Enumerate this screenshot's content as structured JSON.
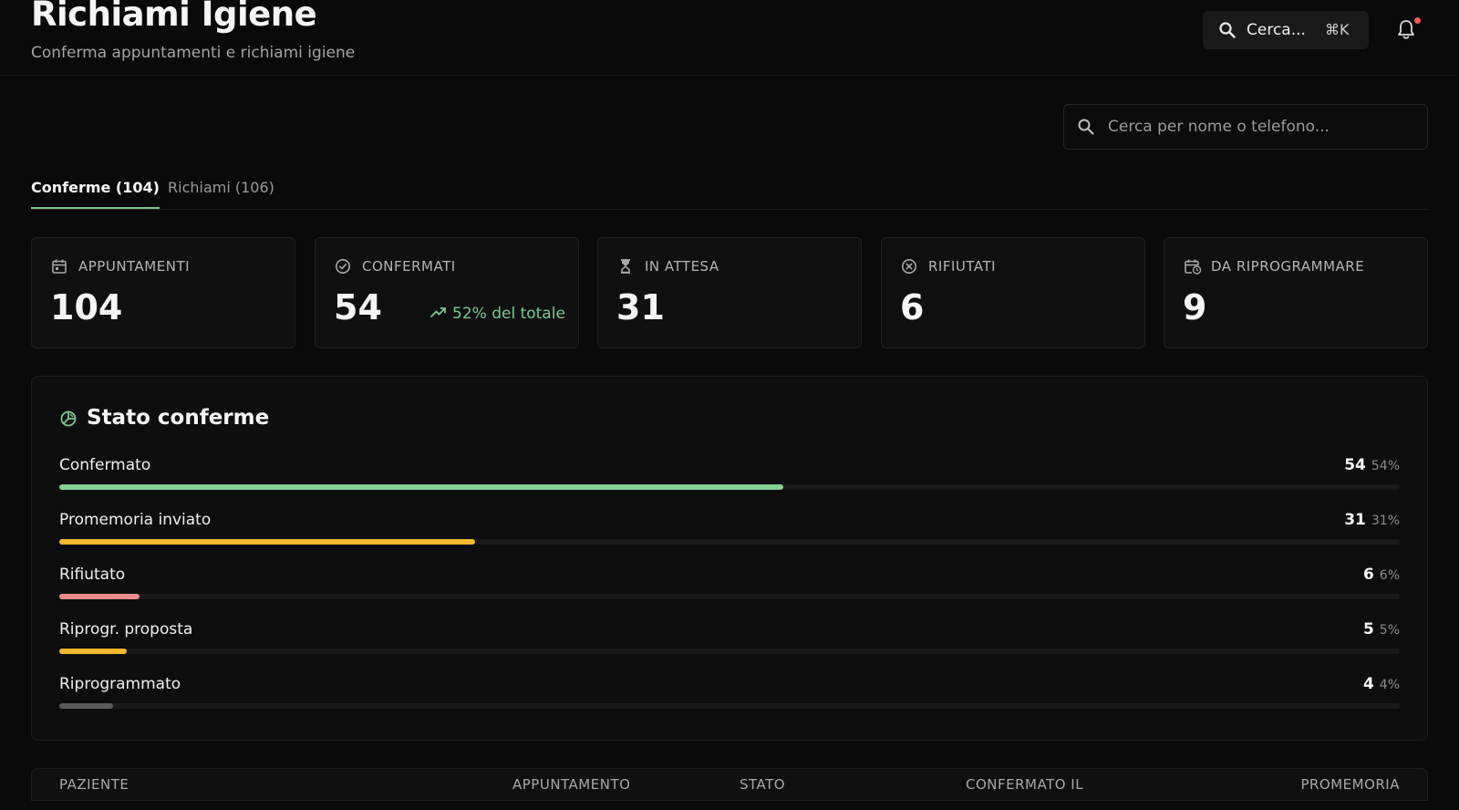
{
  "header": {
    "title": "Richiami Igiene",
    "subtitle": "Conferma appuntamenti e richiami igiene",
    "search_label": "Cerca...",
    "search_shortcut": "⌘K"
  },
  "patient_search": {
    "placeholder": "Cerca per nome o telefono..."
  },
  "tabs": [
    {
      "label": "Conferme (104)",
      "active": true
    },
    {
      "label": "Richiami (106)",
      "active": false
    }
  ],
  "stats": [
    {
      "label": "APPUNTAMENTI",
      "value": "104",
      "icon": "calendar-icon"
    },
    {
      "label": "CONFERMATI",
      "value": "54",
      "icon": "check-circle-icon",
      "trend": "52% del totale"
    },
    {
      "label": "IN ATTESA",
      "value": "31",
      "icon": "hourglass-icon"
    },
    {
      "label": "RIFIUTATI",
      "value": "6",
      "icon": "x-circle-icon"
    },
    {
      "label": "DA RIPROGRAMMARE",
      "value": "9",
      "icon": "calendar-clock-icon"
    }
  ],
  "status_panel": {
    "title": "Stato conferme",
    "rows": [
      {
        "label": "Confermato",
        "count": "54",
        "pct": "54%",
        "fraction": 0.54,
        "color": "#86cf95"
      },
      {
        "label": "Promemoria inviato",
        "count": "31",
        "pct": "31%",
        "fraction": 0.31,
        "color": "#f5b82e"
      },
      {
        "label": "Rifiutato",
        "count": "6",
        "pct": "6%",
        "fraction": 0.06,
        "color": "#f08a8a"
      },
      {
        "label": "Riprogr. proposta",
        "count": "5",
        "pct": "5%",
        "fraction": 0.05,
        "color": "#f5b82e"
      },
      {
        "label": "Riprogrammato",
        "count": "4",
        "pct": "4%",
        "fraction": 0.04,
        "color": "#5a5a5a"
      }
    ]
  },
  "table": {
    "columns": [
      "PAZIENTE",
      "APPUNTAMENTO",
      "STATO",
      "CONFERMATO IL",
      "PROMEMORIA"
    ]
  },
  "colors": {
    "accent": "#7cc893",
    "background": "#0a0a0a",
    "notification": "#ef5a5a"
  }
}
